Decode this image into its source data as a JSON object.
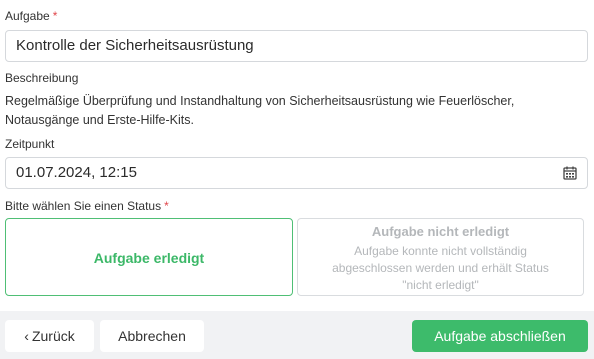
{
  "task": {
    "label": "Aufgabe",
    "required_mark": "*",
    "value": "Kontrolle der Sicherheitsausrüstung"
  },
  "description": {
    "label": "Beschreibung",
    "text": "Regelmäßige Überprüfung und Instandhaltung von Sicherheitsausrüstung wie Feuerlöscher, Notausgänge und Erste-Hilfe-Kits."
  },
  "time": {
    "label": "Zeitpunkt",
    "value": "01.07.2024, 12:15",
    "icon": "calendar-icon"
  },
  "status": {
    "label": "Bitte wählen Sie einen Status",
    "required_mark": "*",
    "done": {
      "title": "Aufgabe erledigt",
      "selected": true,
      "color": "#3cb868"
    },
    "not_done": {
      "title": "Aufgabe nicht erledigt",
      "subtitle": "Aufgabe konnte nicht vollständig abgeschlossen werden und erhält Status \"nicht erledigt\"",
      "selected": false
    }
  },
  "footer": {
    "back_label": "Zurück",
    "back_icon": "chevron-left-icon",
    "cancel_label": "Abbrechen",
    "finish_label": "Aufgabe abschließen",
    "finish_color": "#3dbb6b"
  }
}
